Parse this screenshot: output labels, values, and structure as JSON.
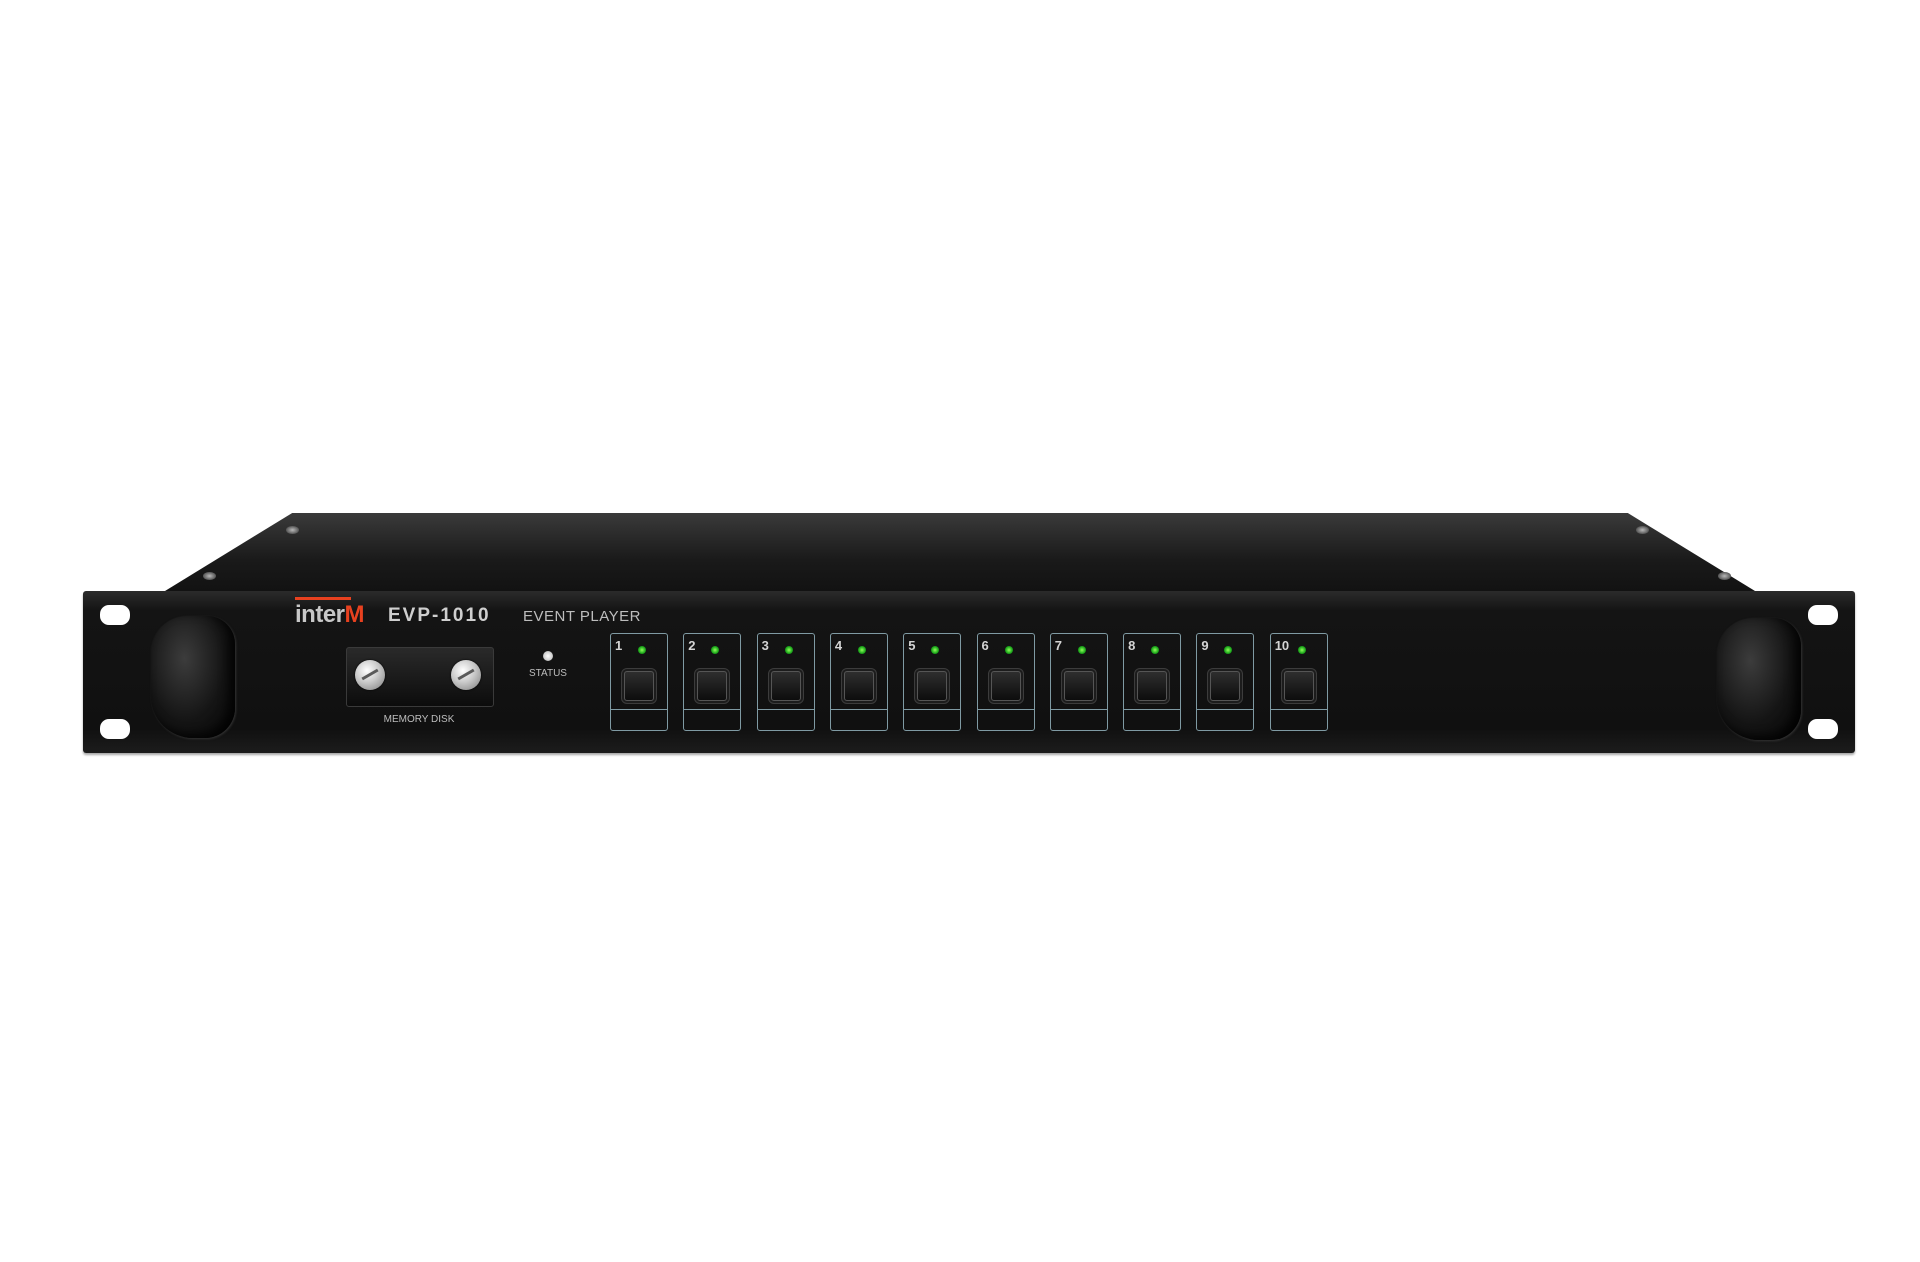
{
  "device": {
    "brand": {
      "main": "inter",
      "tail": "M",
      "accent_color": "#e8411f"
    },
    "model": "EVP-1010",
    "subtitle": "EVENT PLAYER",
    "memory_label": "MEMORY DISK",
    "status_label": "STATUS",
    "channel_led_color": "#2ecc2e",
    "channels": [
      "1",
      "2",
      "3",
      "4",
      "5",
      "6",
      "7",
      "8",
      "9",
      "10"
    ]
  }
}
